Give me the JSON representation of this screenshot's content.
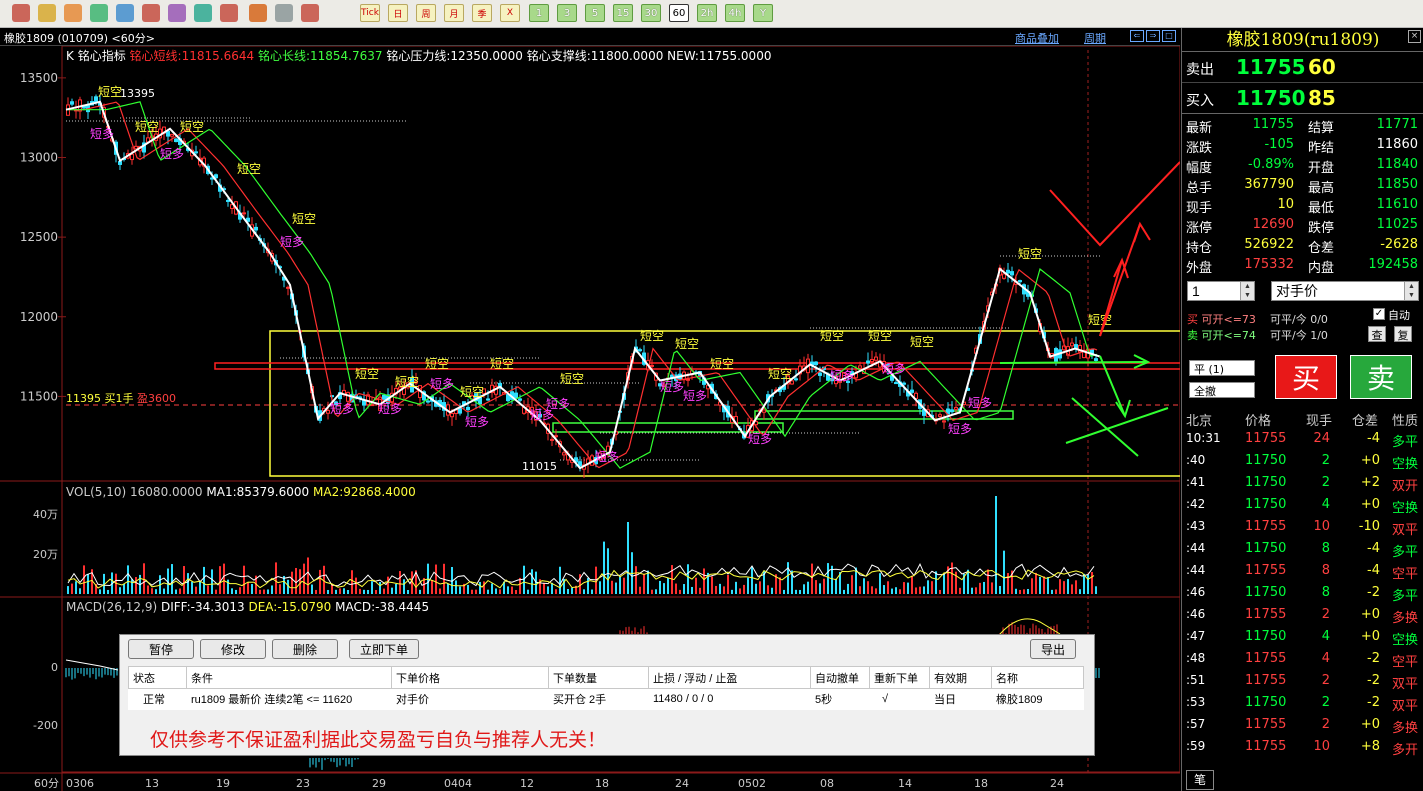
{
  "toolbar": {
    "text_buttons": [
      "Tick",
      "日",
      "周",
      "月",
      "季",
      "X"
    ],
    "period_buttons": [
      "1",
      "3",
      "5",
      "15",
      "30",
      "60",
      "2h",
      "4h",
      "Y"
    ]
  },
  "window": {
    "title": "橡胶1809 (010709) <60分>",
    "links": [
      "商品叠加",
      "周期"
    ]
  },
  "indicator_line": [
    {
      "text": "K",
      "color": "#ffffff"
    },
    {
      "text": "铭心指标",
      "color": "#ffffff"
    },
    {
      "text": "铭心短线:11815.6644",
      "color": "#ff3030"
    },
    {
      "text": "铭心长线:11854.7637",
      "color": "#40ff40"
    },
    {
      "text": "铭心压力线:12350.0000",
      "color": "#ffffff"
    },
    {
      "text": "铭心支撑线:11800.0000",
      "color": "#ffffff"
    },
    {
      "text": "NEW:11755.0000",
      "color": "#ffffff"
    }
  ],
  "price_axis": [
    "13500",
    "13000",
    "12500",
    "12000",
    "11500"
  ],
  "labels": {
    "high": "13395",
    "low": "11015",
    "position": "11395 买1手",
    "position_pl": "盈3600",
    "short": "短空",
    "long": "短多"
  },
  "vol_line": [
    {
      "text": "VOL(5,10) 16080.0000",
      "color": "#cccccc"
    },
    {
      "text": "MA1:85379.6000",
      "color": "#ffffff"
    },
    {
      "text": "MA2:92868.4000",
      "color": "#ffff3c"
    }
  ],
  "vol_axis": [
    "40万",
    "20万"
  ],
  "macd_line": [
    {
      "text": "MACD(26,12,9)",
      "color": "#cccccc"
    },
    {
      "text": "DIFF:-34.3013",
      "color": "#ffffff"
    },
    {
      "text": "DEA:-15.0790",
      "color": "#ffff3c"
    },
    {
      "text": "MACD:-38.4445",
      "color": "#ffffff"
    }
  ],
  "macd_axis": [
    "0",
    "-200"
  ],
  "date_axis": [
    "60分",
    "0306",
    "13",
    "19",
    "23",
    "29",
    "0404",
    "12",
    "18",
    "24",
    "0502",
    "08",
    "14",
    "18",
    "24"
  ],
  "order_panel": {
    "buttons": [
      "暂停",
      "修改",
      "删除",
      "立即下单",
      "导出"
    ],
    "headers": [
      "状态",
      "条件",
      "下单价格",
      "下单数量",
      "止损 / 浮动 / 止盈",
      "自动撤单",
      "重新下单",
      "有效期",
      "名称"
    ],
    "row": [
      "正常",
      "ru1809 最新价 连续2笔 <= 11620",
      "对手价",
      "买开仓 2手",
      "11480 / 0 / 0",
      "5秒",
      "√",
      "当日",
      "橡胶1809"
    ],
    "disclaimer": "仅供参考不保证盈利据此交易盈亏自负与推荐人无关！"
  },
  "quote": {
    "title": "橡胶1809(ru1809)",
    "close_icon": "×",
    "sell": {
      "label": "卖出",
      "price": "11755",
      "vol": "60"
    },
    "buy": {
      "label": "买入",
      "price": "11750",
      "vol": "85"
    },
    "rows": [
      {
        "l1": "最新",
        "v1": "11755",
        "c1": "#00ff3c",
        "l2": "结算",
        "v2": "11771",
        "c2": "#00ff3c"
      },
      {
        "l1": "涨跌",
        "v1": "-105",
        "c1": "#00ff3c",
        "l2": "昨结",
        "v2": "11860",
        "c2": "#ffffff"
      },
      {
        "l1": "幅度",
        "v1": "-0.89%",
        "c1": "#00ff3c",
        "l2": "开盘",
        "v2": "11840",
        "c2": "#00ff3c"
      },
      {
        "l1": "总手",
        "v1": "367790",
        "c1": "#ffff3c",
        "l2": "最高",
        "v2": "11850",
        "c2": "#00ff3c"
      },
      {
        "l1": "现手",
        "v1": "10",
        "c1": "#ffff3c",
        "l2": "最低",
        "v2": "11610",
        "c2": "#00ff3c"
      },
      {
        "l1": "涨停",
        "v1": "12690",
        "c1": "#ff4040",
        "l2": "跌停",
        "v2": "11025",
        "c2": "#00ff3c"
      },
      {
        "l1": "持仓",
        "v1": "526922",
        "c1": "#ffff3c",
        "l2": "仓差",
        "v2": "-2628",
        "c2": "#ffff3c"
      },
      {
        "l1": "外盘",
        "v1": "175332",
        "c1": "#ff4040",
        "l2": "内盘",
        "v2": "192458",
        "c2": "#00ff3c"
      }
    ],
    "qty": "1",
    "price_type": "对手价",
    "buy_info": {
      "a": "买",
      "b": "可开<=73",
      "c": "可平/今 0/0"
    },
    "sell_info": {
      "a": "卖",
      "b": "可开<=74",
      "c": "可平/今 1/0"
    },
    "auto_label": "自动",
    "check_btn": "查",
    "copy_btn": "复",
    "close_btn": "平 (1)",
    "cancel_btn": "全撤",
    "buy_btn": "买",
    "sell_btn": "卖",
    "tick_header": [
      "北京",
      "价格",
      "现手",
      "仓差",
      "性质"
    ],
    "ticks": [
      [
        "10:31",
        "11755",
        "24",
        "-4",
        "多平"
      ],
      [
        ":40",
        "11750",
        "2",
        "+0",
        "空换"
      ],
      [
        ":41",
        "11750",
        "2",
        "+2",
        "双开"
      ],
      [
        ":42",
        "11750",
        "4",
        "+0",
        "空换"
      ],
      [
        ":43",
        "11755",
        "10",
        "-10",
        "双平"
      ],
      [
        ":44",
        "11750",
        "8",
        "-4",
        "多平"
      ],
      [
        ":44",
        "11755",
        "8",
        "-4",
        "空平"
      ],
      [
        ":46",
        "11750",
        "8",
        "-2",
        "多平"
      ],
      [
        ":46",
        "11755",
        "2",
        "+0",
        "多换"
      ],
      [
        ":47",
        "11750",
        "4",
        "+0",
        "空换"
      ],
      [
        ":48",
        "11755",
        "4",
        "-2",
        "空平"
      ],
      [
        ":51",
        "11755",
        "2",
        "-2",
        "双平"
      ],
      [
        ":53",
        "11750",
        "2",
        "-2",
        "双平"
      ],
      [
        ":57",
        "11755",
        "2",
        "+0",
        "多换"
      ],
      [
        ":59",
        "11755",
        "10",
        "+8",
        "多开"
      ]
    ],
    "tab": "笔"
  }
}
